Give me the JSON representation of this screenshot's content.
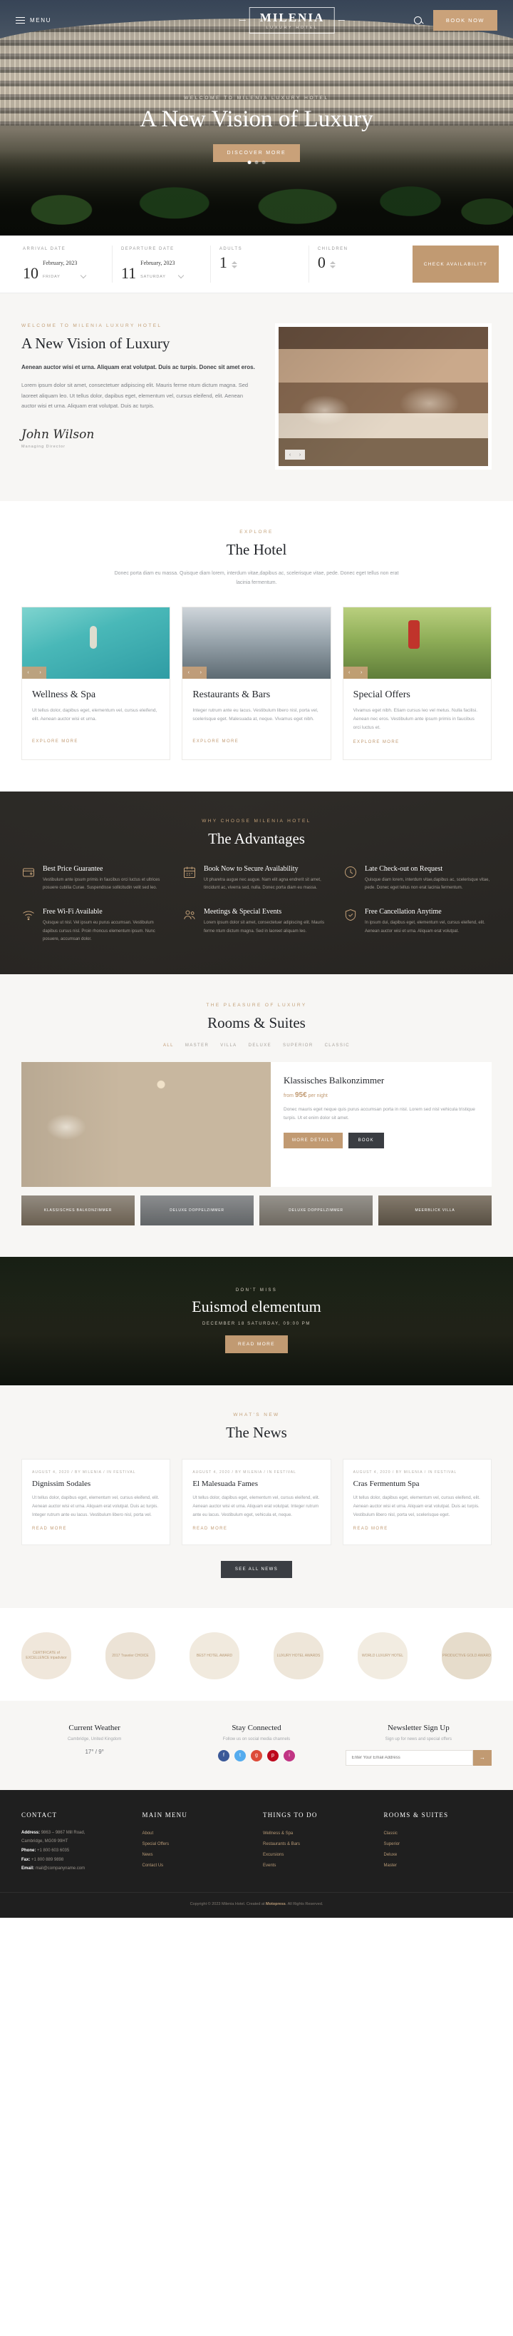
{
  "header": {
    "menu_label": "MENU",
    "logo_main": "MILENIA",
    "logo_sub": "LUXURY HOTEL",
    "book_now": "BOOK NOW"
  },
  "hero": {
    "eyebrow": "WELCOME TO MILENIA LUXURY HOTEL",
    "title": "A New Vision of Luxury",
    "cta": "DISCOVER MORE"
  },
  "booking": {
    "arrival_label": "ARRIVAL DATE",
    "arrival_day": "10",
    "arrival_month": "February, 2023",
    "arrival_dow": "FRIDAY",
    "departure_label": "DEPARTURE DATE",
    "departure_day": "11",
    "departure_month": "February, 2023",
    "departure_dow": "SATURDAY",
    "adults_label": "ADULTS",
    "adults_value": "1",
    "children_label": "CHILDREN",
    "children_value": "0",
    "submit": "CHECK AVAILABILITY"
  },
  "welcome": {
    "eyebrow": "WELCOME TO MILENIA LUXURY HOTEL",
    "title": "A New Vision of Luxury",
    "lead": "Aenean auctor wisi et urna. Aliquam erat volutpat. Duis ac turpis. Donec sit amet eros.",
    "body": "Lorem ipsum dolor sit amet, consectetuer adipiscing elit. Mauris ferme ntum dictum magna. Sed laoreet aliquam leo. Ut tellus dolor, dapibus eget, elementum vel, cursus eleifend, elit. Aenean auctor wisi et urna. Aliquam erat volutpat. Duis ac turpis.",
    "signature": "John Wilson",
    "role": "Managing Director",
    "nav_prev": "‹",
    "nav_next": "›"
  },
  "hotel": {
    "eyebrow": "EXPLORE",
    "title": "The Hotel",
    "sub": "Donec porta diam eu massa. Quisque diam lorem, interdum vitae,dapibus ac, scelerisque vitae, pede. Donec eget tellus non erat lacinia fermentum.",
    "cards": [
      {
        "title": "Wellness & Spa",
        "text": "Ut tellus dolor, dapibus eget, elementum vel, cursus eleifend, elit. Aenean auctor wisi et urna.",
        "link": "EXPLORE MORE"
      },
      {
        "title": "Restaurants & Bars",
        "text": "Integer rutrum ante eu lacus. Vestibulum libero nisl, porta vel, scelerisque eget. Malesuada at, neque. Vivamus eget nibh.",
        "link": "EXPLORE MORE"
      },
      {
        "title": "Special Offers",
        "text": "Vivamus eget nibh. Etiam cursus leo vel metus. Nulla facilisi. Aenean nec eros. Vestibulum ante ipsum primis in faucibus orci luctus et.",
        "link": "EXPLORE MORE"
      }
    ]
  },
  "advantages": {
    "eyebrow": "WHY CHOOSE MILENIA HOTEL",
    "title": "The Advantages",
    "items": [
      {
        "icon": "wallet-icon",
        "title": "Best Price Guarantee",
        "text": "Vestibulum ante ipsum primis in faucibus orci luctus et ultrices posuere cubilia Curae. Suspendisse sollicitudin velit sed leo."
      },
      {
        "icon": "calendar-icon",
        "title": "Book Now to Secure Availability",
        "text": "Ut pharetra augue nec augue. Nam elit agna endrerit sit amet, tincidunt ac, viverra sed, nulla. Donec porta diam eu massa."
      },
      {
        "icon": "clock-icon",
        "title": "Late Check-out on Request",
        "text": "Quisque diam lorem, interdum vitae,dapibus ac, scelerisque vitae, pede. Donec eget tellus non erat lacinia fermentum."
      },
      {
        "icon": "wifi-icon",
        "title": "Free Wi-Fi Available",
        "text": "Quisque ut nisl. Vel ipsum eu purus accumsan. Vestibulum dapibus cursus nisl. Proin rhoncus elementum ipsum. Nunc posuere, accumsan dolor."
      },
      {
        "icon": "users-icon",
        "title": "Meetings & Special Events",
        "text": "Lorem ipsum dolor sit amet, consectetuer adipiscing elit. Mauris ferme ntum dictum magna. Sed in laoreet aliquam leo."
      },
      {
        "icon": "shield-icon",
        "title": "Free Cancellation Anytime",
        "text": "In ipsum dui, dapibus eget, elementum vel, cursus eleifend, elit. Aenean auctor wisi et urna. Aliquam erat volutpat."
      }
    ]
  },
  "rooms": {
    "eyebrow": "THE PLEASURE OF LUXURY",
    "title": "Rooms & Suites",
    "filters": [
      "ALL",
      "MASTER",
      "VILLA",
      "DELUXE",
      "SUPERIOR",
      "CLASSIC"
    ],
    "active_filter": "ALL",
    "room_title": "Klassisches Balkonzimmer",
    "price_prefix": "from",
    "price": "95€",
    "price_suffix": "per night",
    "desc": "Donec mauris eget neque quis purus accumsan porta in nisl. Lorem sed nisl vehicula tristique turpis. Ut et enim dolor sit amet.",
    "btn_details": "MORE DETAILS",
    "btn_book": "BOOK",
    "thumbs": [
      "KLASSISCHES BALKONZIMMER",
      "DELUXE DOPPELZIMMER",
      "DELUXE DOPPELZIMMER",
      "MEERBLICK VILLA"
    ]
  },
  "promo": {
    "eyebrow": "DON'T MISS",
    "title": "Euismod elementum",
    "date": "DECEMBER 18 SATURDAY, 09:00 PM",
    "cta": "READ MORE"
  },
  "news": {
    "eyebrow": "WHAT'S NEW",
    "title": "The News",
    "items": [
      {
        "meta": "AUGUST 4, 2020 / BY MILENIA / IN FESTIVAL",
        "title": "Dignissim Sodales",
        "text": "Ut tellus dolor, dapibus eget, elementum vel, cursus eleifend, elit. Aenean auctor wisi et urna. Aliquam erat volutpat. Duis ac turpis. Integer rutrum ante eu lacus. Vestibulum libero nisl, porta vel.",
        "link": "READ MORE"
      },
      {
        "meta": "AUGUST 4, 2020 / BY MILENIA / IN FESTIVAL",
        "title": "El Malesuada Fames",
        "text": "Ut tellus dolor, dapibus eget, elementum vel, cursus eleifend, elit. Aenean auctor wisi et urna. Aliquam erat volutpat. Integer rutrum ante eu lacus. Vestibulum eget, vehicula et, neque.",
        "link": "READ MORE"
      },
      {
        "meta": "AUGUST 4, 2020 / BY MILENIA / IN FESTIVAL",
        "title": "Cras Fermentum Spa",
        "text": "Ut tellus dolor, dapibus eget, elementum vel, cursus eleifend, elit. Aenean auctor wisi et urna. Aliquam erat volutpat. Duis ac turpis. Vestibulum libero nisl, porta vel, scelerisque eget.",
        "link": "READ MORE"
      }
    ],
    "see_all": "SEE ALL NEWS"
  },
  "awards": [
    {
      "name": "award-badge-1",
      "text": "CERTIFICATE of EXCELLENCE tripadvisor"
    },
    {
      "name": "award-badge-2",
      "text": "2017 Traveler CHOICE"
    },
    {
      "name": "award-badge-3",
      "text": "BEST HOTEL AWARD"
    },
    {
      "name": "award-badge-4",
      "text": "LUXURY HOTEL AWARDS"
    },
    {
      "name": "award-badge-5",
      "text": "WORLD LUXURY HOTEL"
    },
    {
      "name": "award-badge-6",
      "text": "PRODUCTIVE GOLD AWARD"
    }
  ],
  "footer_widgets": {
    "weather": {
      "title": "Current Weather",
      "sub": "Cambridge, United Kingdom",
      "value": "17° / 9°"
    },
    "social": {
      "title": "Stay Connected",
      "sub": "Follow us on social media channels",
      "icons": [
        "facebook-icon",
        "twitter-icon",
        "google-plus-icon",
        "pinterest-icon",
        "instagram-icon"
      ]
    },
    "newsletter": {
      "title": "Newsletter Sign Up",
      "sub": "Sign up for news and special offers",
      "placeholder": "Enter Your Email Address",
      "button": "→"
    }
  },
  "footer": {
    "contact": {
      "heading": "CONTACT",
      "address_label": "Address:",
      "address_value": "9863 – 9867 Mill Road,",
      "address_line2": "Cambridge, MG09 99HT",
      "phone_label": "Phone:",
      "phone_value": "+1 800 603 6035",
      "fax_label": "Fax:",
      "fax_value": "+1 800 889 9898",
      "email_label": "Email:",
      "email_value": "mail@companyname.com"
    },
    "main_menu": {
      "heading": "MAIN MENU",
      "links": [
        "About",
        "Special Offers",
        "News",
        "Contact Us"
      ]
    },
    "things": {
      "heading": "THINGS TO DO",
      "links": [
        "Wellness & Spa",
        "Restaurants & Bars",
        "Excursions",
        "Events"
      ]
    },
    "rooms": {
      "heading": "ROOMS & SUITES",
      "links": [
        "Classic",
        "Superior",
        "Deluxe",
        "Master"
      ]
    },
    "copyright_prefix": "Copyright © 2023 Milenia Hotel. Created at ",
    "copyright_brand": "Motopress",
    "copyright_suffix": ". All Rights Reserved."
  }
}
